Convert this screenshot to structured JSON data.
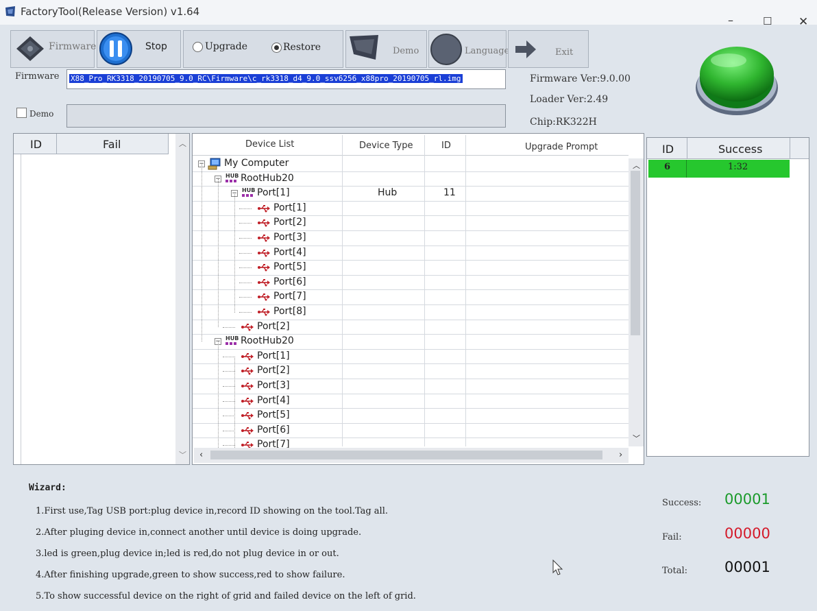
{
  "window": {
    "title": "FactoryTool(Release Version) v1.64",
    "controls": [
      "–",
      "☐",
      "✕"
    ]
  },
  "toolbar": {
    "firmware_label": "Firmware",
    "stop_label": "Stop",
    "upgrade_label": "Upgrade",
    "restore_label": "Restore",
    "mode_selected": "Restore",
    "demo_label": "Demo",
    "language_label": "Language",
    "exit_label": "Exit"
  },
  "firmware": {
    "label": "Firmware",
    "path": "X88_Pro_RK3318_20190705_9.0_RC\\Firmware\\c_rk3318_d4_9.0_ssv6256_x88pro_20190705_rl.img",
    "demo_checkbox_label": "Demo",
    "demo_checked": false
  },
  "info": {
    "firmware_ver": "Firmware Ver:9.0.00",
    "loader_ver": "Loader Ver:2.49",
    "chip": "Chip:RK322H"
  },
  "status_indicator": {
    "color": "#2fb52f",
    "state": "green"
  },
  "fail_grid": {
    "headers": [
      "ID",
      "Fail"
    ],
    "rows": []
  },
  "device_list": {
    "headers": [
      "Device List",
      "Device Type",
      "ID",
      "Upgrade Prompt"
    ],
    "rows": [
      {
        "label": "My Computer",
        "type": "",
        "id": "",
        "kind": "computer",
        "level": 0,
        "expander": "−"
      },
      {
        "label": "RootHub20",
        "type": "",
        "id": "",
        "kind": "hub",
        "level": 1,
        "expander": "−"
      },
      {
        "label": "Port[1]",
        "type": "Hub",
        "id": "11",
        "kind": "hub",
        "level": 2,
        "expander": "−"
      },
      {
        "label": "Port[1]",
        "type": "",
        "id": "",
        "kind": "usb",
        "level": 3
      },
      {
        "label": "Port[2]",
        "type": "",
        "id": "",
        "kind": "usb",
        "level": 3
      },
      {
        "label": "Port[3]",
        "type": "",
        "id": "",
        "kind": "usb",
        "level": 3
      },
      {
        "label": "Port[4]",
        "type": "",
        "id": "",
        "kind": "usb",
        "level": 3
      },
      {
        "label": "Port[5]",
        "type": "",
        "id": "",
        "kind": "usb",
        "level": 3
      },
      {
        "label": "Port[6]",
        "type": "",
        "id": "",
        "kind": "usb",
        "level": 3
      },
      {
        "label": "Port[7]",
        "type": "",
        "id": "",
        "kind": "usb",
        "level": 3
      },
      {
        "label": "Port[8]",
        "type": "",
        "id": "",
        "kind": "usb",
        "level": 3
      },
      {
        "label": "Port[2]",
        "type": "",
        "id": "",
        "kind": "usb",
        "level": 2
      },
      {
        "label": "RootHub20",
        "type": "",
        "id": "",
        "kind": "hub",
        "level": 1,
        "expander": "−"
      },
      {
        "label": "Port[1]",
        "type": "",
        "id": "",
        "kind": "usb",
        "level": 2
      },
      {
        "label": "Port[2]",
        "type": "",
        "id": "",
        "kind": "usb",
        "level": 2
      },
      {
        "label": "Port[3]",
        "type": "",
        "id": "",
        "kind": "usb",
        "level": 2
      },
      {
        "label": "Port[4]",
        "type": "",
        "id": "",
        "kind": "usb",
        "level": 2
      },
      {
        "label": "Port[5]",
        "type": "",
        "id": "",
        "kind": "usb",
        "level": 2
      },
      {
        "label": "Port[6]",
        "type": "",
        "id": "",
        "kind": "usb",
        "level": 2
      },
      {
        "label": "Port[7]",
        "type": "",
        "id": "",
        "kind": "usb",
        "level": 2
      }
    ]
  },
  "success_grid": {
    "headers": [
      "ID",
      "Success"
    ],
    "rows": [
      {
        "id": "6",
        "time": "1:32"
      }
    ]
  },
  "wizard": {
    "title": "Wizard:",
    "lines": [
      "1.First use,Tag USB port:plug device in,record ID showing on the tool.Tag all.",
      "2.After pluging device in,connect another until device is doing upgrade.",
      "3.led is green,plug device in;led is red,do not plug device in or out.",
      "4.After finishing upgrade,green to show success,red to show failure.",
      "5.To show successful device on the right of grid and failed device on the left of grid."
    ]
  },
  "stats": {
    "success_label": "Success:",
    "success_value": "00001",
    "success_color": "#1a9a2a",
    "fail_label": "Fail:",
    "fail_value": "00000",
    "fail_color": "#d41a2a",
    "total_label": "Total:",
    "total_value": "00001",
    "total_color": "#111111"
  }
}
